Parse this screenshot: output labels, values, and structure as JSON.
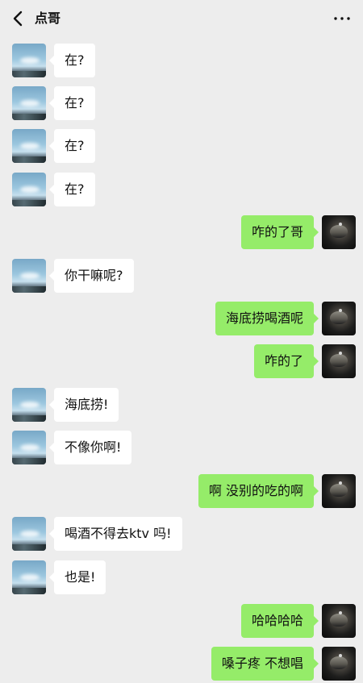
{
  "header": {
    "title": "点哥",
    "back_icon": "chevron-left-icon",
    "more_icon": "more-icon"
  },
  "colors": {
    "background": "#ededed",
    "incoming_bubble": "#ffffff",
    "outgoing_bubble": "#95ec69",
    "text": "#111111"
  },
  "messages": [
    {
      "side": "left",
      "text": "在?"
    },
    {
      "side": "left",
      "text": "在?"
    },
    {
      "side": "left",
      "text": "在?"
    },
    {
      "side": "left",
      "text": "在?"
    },
    {
      "side": "right",
      "text": "咋的了哥"
    },
    {
      "side": "left",
      "text": "你干嘛呢?"
    },
    {
      "side": "right",
      "text": "海底捞喝酒呢"
    },
    {
      "side": "right",
      "text": "咋的了"
    },
    {
      "side": "left",
      "text": "海底捞!"
    },
    {
      "side": "left",
      "text": "不像你啊!"
    },
    {
      "side": "right",
      "text": "啊 没别的吃的啊"
    },
    {
      "side": "left",
      "text": "喝酒不得去ktv 吗!"
    },
    {
      "side": "left",
      "text": "也是!"
    },
    {
      "side": "right",
      "text": "哈哈哈哈"
    },
    {
      "side": "right",
      "text": "嗓子疼 不想唱"
    }
  ]
}
